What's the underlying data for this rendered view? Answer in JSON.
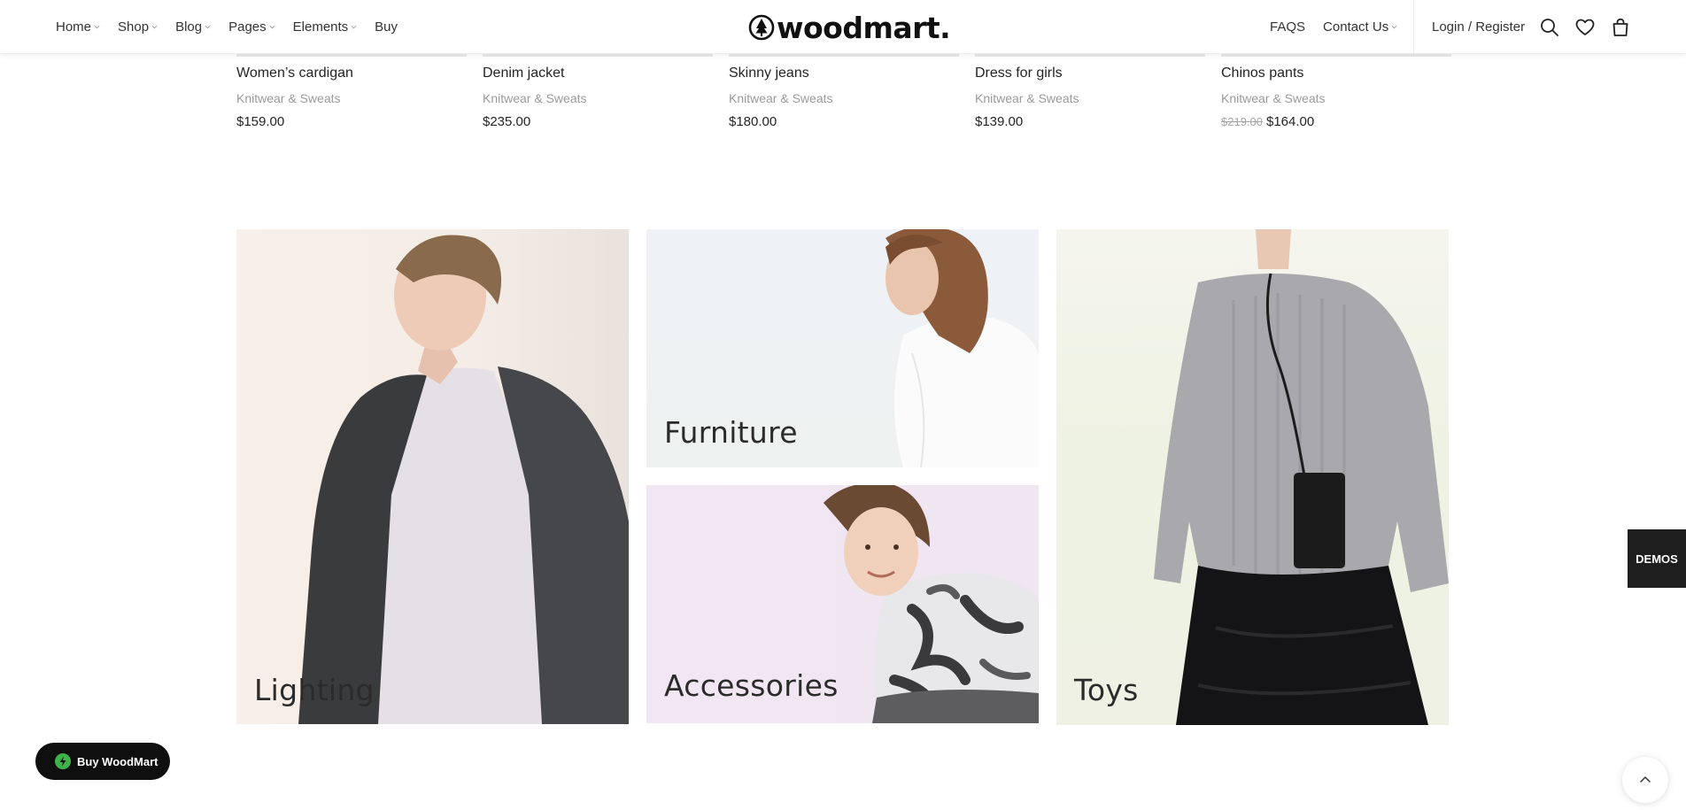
{
  "header": {
    "nav_left": [
      {
        "label": "Home",
        "has_dropdown": true
      },
      {
        "label": "Shop",
        "has_dropdown": true
      },
      {
        "label": "Blog",
        "has_dropdown": true
      },
      {
        "label": "Pages",
        "has_dropdown": true
      },
      {
        "label": "Elements",
        "has_dropdown": true
      },
      {
        "label": "Buy",
        "has_dropdown": false
      }
    ],
    "logo_text": "woodmart.",
    "nav_right": [
      {
        "label": "FAQS",
        "has_dropdown": false
      },
      {
        "label": "Contact Us",
        "has_dropdown": true
      }
    ],
    "login_label": "Login / Register",
    "icons": [
      "search-icon",
      "heart-icon",
      "cart-icon"
    ]
  },
  "products": [
    {
      "title": "Women’s cardigan",
      "category": "Knitwear & Sweats",
      "price": "$159.00",
      "old_price": ""
    },
    {
      "title": "Denim jacket",
      "category": "Knitwear & Sweats",
      "price": "$235.00",
      "old_price": ""
    },
    {
      "title": "Skinny jeans",
      "category": "Knitwear & Sweats",
      "price": "$180.00",
      "old_price": ""
    },
    {
      "title": "Dress for girls",
      "category": "Knitwear & Sweats",
      "price": "$139.00",
      "old_price": ""
    },
    {
      "title": "Chinos pants",
      "category": "Knitwear & Sweats",
      "price": "$164.00",
      "old_price": "$219.00"
    }
  ],
  "categories": [
    {
      "label": "Lighting"
    },
    {
      "label": "Furniture"
    },
    {
      "label": "Accessories"
    },
    {
      "label": "Toys"
    }
  ],
  "floating": {
    "buy_label": "Buy WoodMart",
    "demos_label": "DEMOS"
  },
  "colors": {
    "accent_green": "#3fb24a",
    "dark": "#0f0f0f",
    "tile_lighting_bg": "#f7efe9",
    "tile_furniture_bg": "#eef2f6",
    "tile_accessories_bg": "#f1e6f3",
    "tile_toys_bg": "#eef2e4"
  }
}
